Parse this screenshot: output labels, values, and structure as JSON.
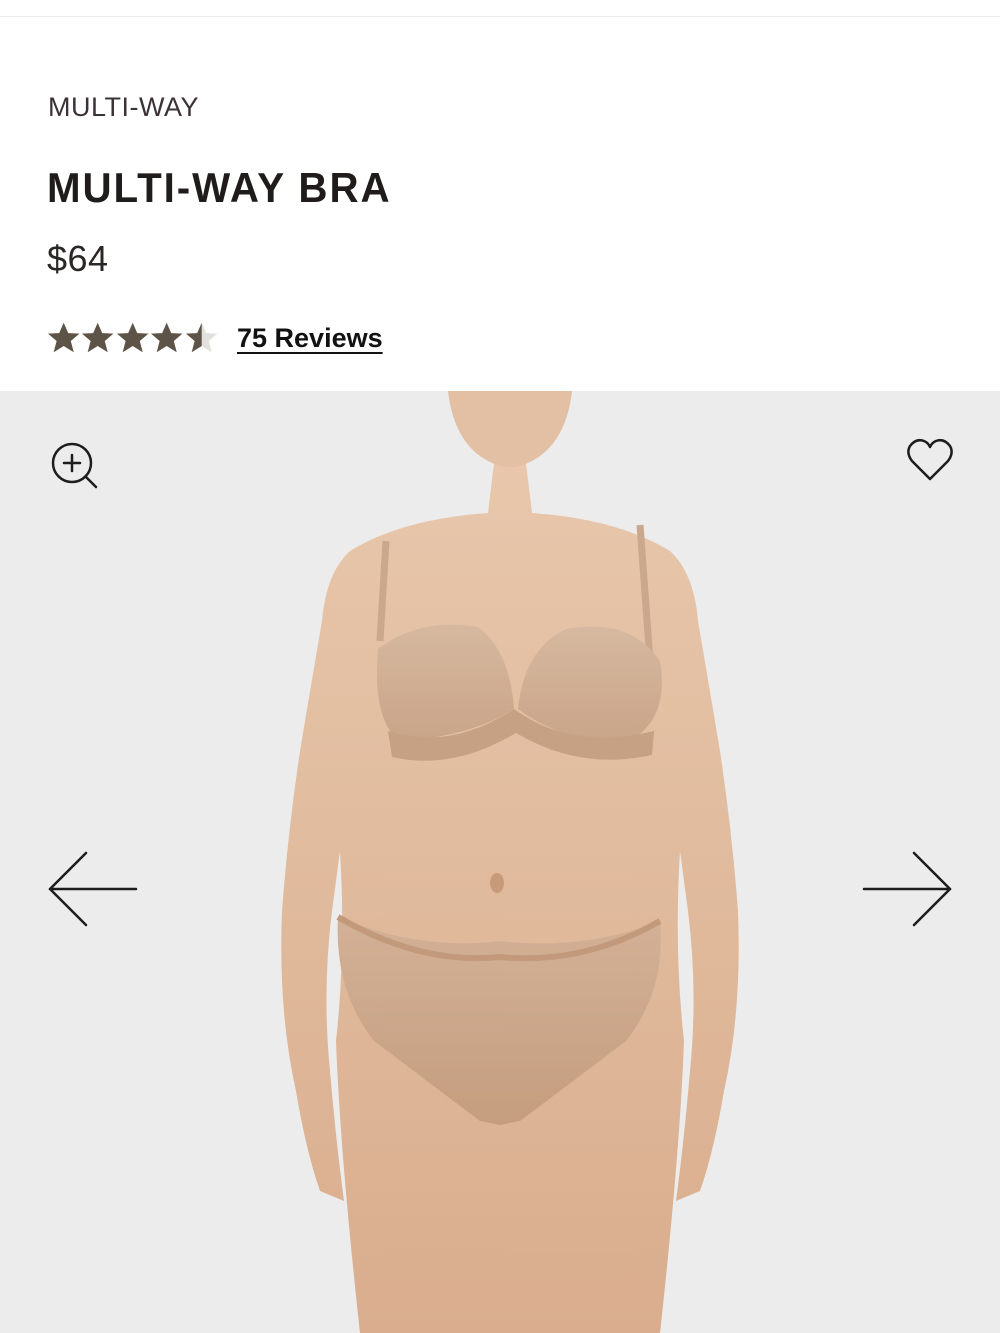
{
  "product": {
    "collection": "MULTI-WAY",
    "title": "MULTI-WAY BRA",
    "price": "$64"
  },
  "rating": {
    "value": 4.5,
    "max": 5,
    "reviews_label": "75 Reviews",
    "filled_color": "#5e5347",
    "empty_color": "#e3e1de"
  },
  "gallery": {
    "background": "#ececec",
    "image_subject": "Model wearing nude strapless multi-way bra with matching thong",
    "zoom_icon": "zoom-in-icon",
    "wishlist_icon": "heart-outline-icon",
    "prev_icon": "arrow-left-icon",
    "next_icon": "arrow-right-icon"
  }
}
